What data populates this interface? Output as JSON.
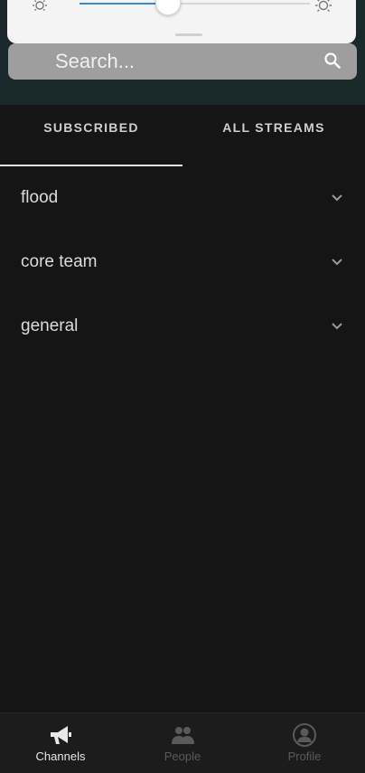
{
  "search": {
    "placeholder": "Search..."
  },
  "tabs": [
    {
      "label": "SUBSCRIBED",
      "active": true
    },
    {
      "label": "ALL STREAMS",
      "active": false
    }
  ],
  "streams": [
    {
      "label": "flood"
    },
    {
      "label": "core team"
    },
    {
      "label": "general"
    }
  ],
  "bottom_nav": [
    {
      "label": "Channels",
      "icon": "megaphone-icon",
      "active": true
    },
    {
      "label": "People",
      "icon": "people-icon",
      "active": false
    },
    {
      "label": "Profile",
      "icon": "profile-icon",
      "active": false
    }
  ],
  "brightness_slider": {
    "level": 0.38
  },
  "colors": {
    "background": "#151515",
    "accent": "#3a86d8",
    "active_text": "#e8e8e8",
    "inactive_text": "#5a5a5a"
  }
}
